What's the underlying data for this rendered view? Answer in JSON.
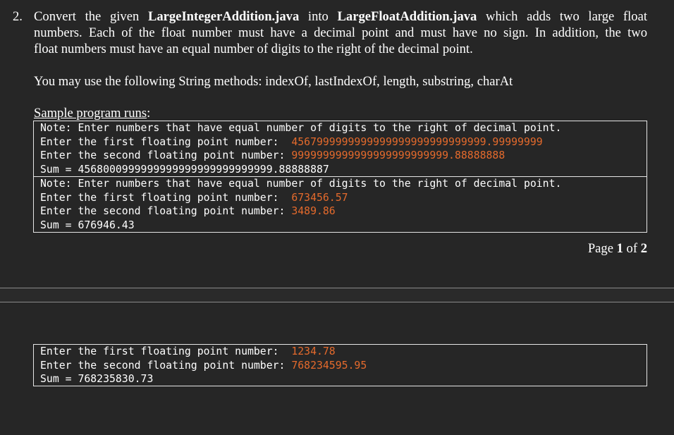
{
  "question": {
    "number": "2.",
    "line1": {
      "t1": "Convert the given ",
      "b1": "LargeIntegerAddition.java",
      "t2": " into ",
      "b2": "LargeFloatAddition.java",
      "t3": " which adds two large float"
    },
    "line2": "numbers. Each of the float number must have a decimal point and must have no sign. In addition, the two",
    "line3": "float numbers must have an equal number of digits to the right of the decimal point.",
    "string_methods": "You may use the following String methods:  indexOf, lastIndexOf, length, substring, charAt",
    "sample_label": "Sample program runs",
    "sample_colon": ":"
  },
  "runs": [
    {
      "note": "Note: Enter numbers that have equal number of digits to the right of decimal point.",
      "first_prompt": "Enter the first floating point number:  ",
      "first_value": "4567999999999999999999999999999.99999999",
      "second_prompt": "Enter the second floating point number: ",
      "second_value": "9999999999999999999999999.88888888",
      "sum_text": "Sum = 4568000999999999999999999999999.88888887"
    },
    {
      "note": "Note: Enter numbers that have equal number of digits to the right of decimal point.",
      "first_prompt": "Enter the first floating point number:  ",
      "first_value": "673456.57",
      "second_prompt": "Enter the second floating point number: ",
      "second_value": "3489.86",
      "sum_text": "Sum = 676946.43"
    },
    {
      "first_prompt": "Enter the first floating point number:  ",
      "first_value": "1234.78",
      "second_prompt": "Enter the second floating point number: ",
      "second_value": "768234595.95",
      "sum_text": "Sum = 768235830.73"
    }
  ],
  "page": {
    "prefix": "Page ",
    "current": "1",
    "middle": " of ",
    "total": "2"
  },
  "colors": {
    "background": "#262626",
    "text": "#ffffff",
    "input_value": "#e46a2c",
    "box_border": "#e6e6e6"
  }
}
